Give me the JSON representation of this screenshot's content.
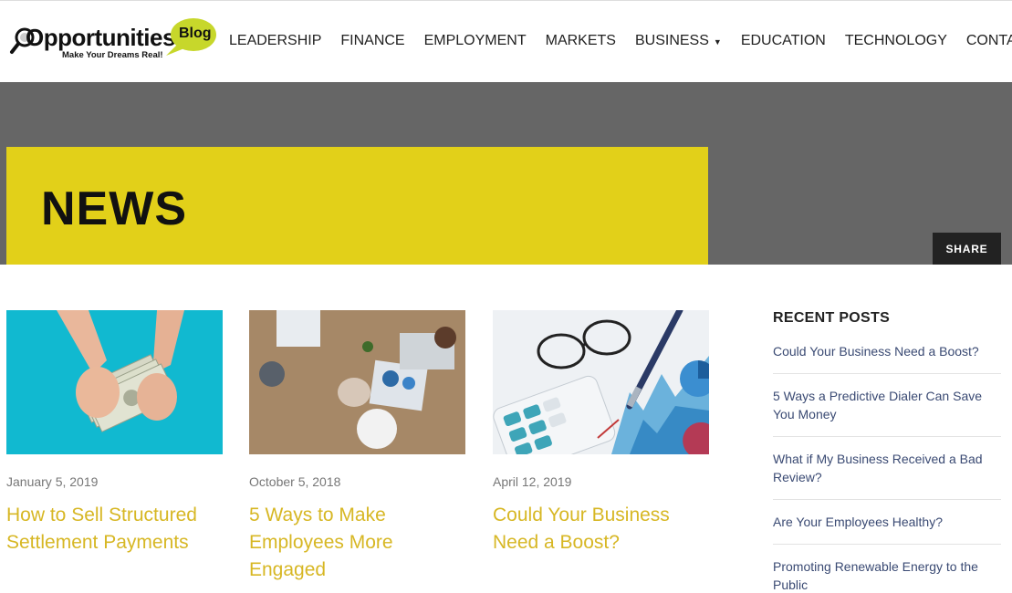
{
  "logo": {
    "word": "Opportunities",
    "bubble": "Blog",
    "tagline": "Make Your Dreams Real!"
  },
  "nav": {
    "items": [
      "LEADERSHIP",
      "FINANCE",
      "EMPLOYMENT",
      "MARKETS",
      "BUSINESS",
      "EDUCATION",
      "TECHNOLOGY",
      "CONTACT"
    ]
  },
  "banner": {
    "title": "NEWS",
    "share_label": "SHARE"
  },
  "posts": [
    {
      "date": "January 5, 2019",
      "title": "How to Sell Structured Settlement Payments"
    },
    {
      "date": "October 5, 2018",
      "title": "5 Ways to Make Employees More Engaged"
    },
    {
      "date": "April 12, 2019",
      "title": "Could Your Business Need a Boost?"
    }
  ],
  "sidebar": {
    "heading": "RECENT POSTS",
    "items": [
      "Could Your Business Need a Boost?",
      "5 Ways a Predictive Dialer Can Save You Money",
      "What if My Business Received a Bad Review?",
      "Are Your Employees Healthy?",
      "Promoting Renewable Energy to the Public"
    ]
  },
  "colors": {
    "accent_yellow": "#e2d019",
    "post_title": "#d7b724",
    "banner_gray": "#666666",
    "link_blue": "#3a4a73"
  }
}
